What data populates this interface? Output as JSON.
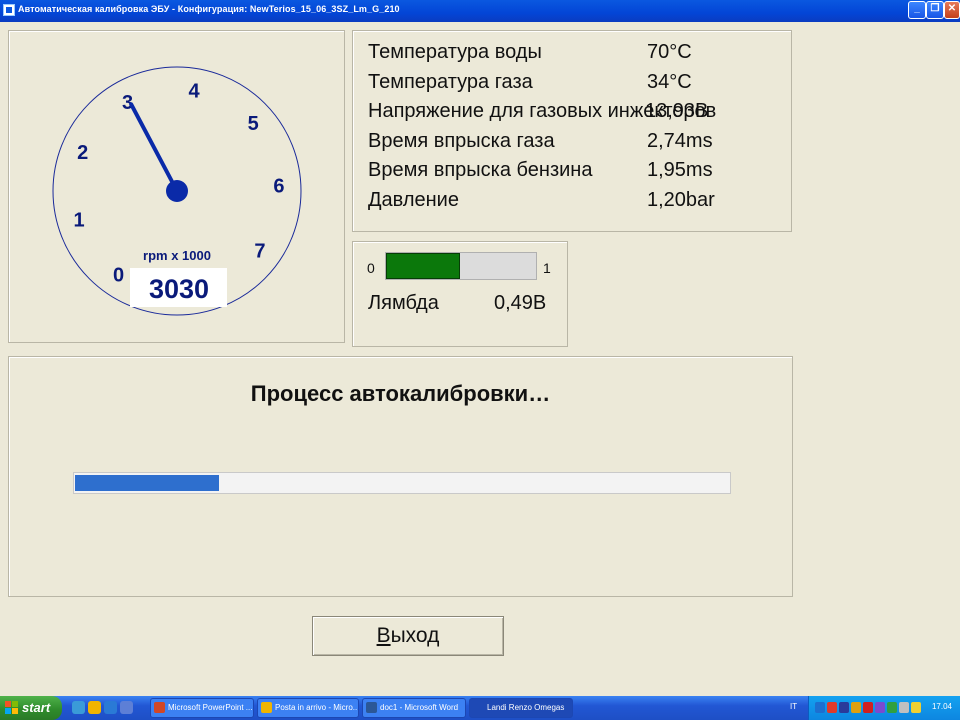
{
  "window": {
    "title": "Автоматическая калибровка ЭБУ - Конфигурация: NewTerios_15_06_3SZ_Lm_G_210"
  },
  "gauge": {
    "scale_labels": [
      "0",
      "1",
      "2",
      "3",
      "4",
      "5",
      "6",
      "7"
    ],
    "unit_label": "rpm x 1000",
    "rpm_value": "3030",
    "needle_value": 3.03,
    "needle_color": "#0a2aa8"
  },
  "parameters": [
    {
      "label": "Температура воды",
      "value": "70°C"
    },
    {
      "label": "Температура газа",
      "value": "34°C"
    },
    {
      "label": "Напряжение для газовых инжекторов",
      "value": "13,93В"
    },
    {
      "label": "Время впрыска газа",
      "value": "2,74ms"
    },
    {
      "label": "Время впрыска бензина",
      "value": "1,95ms"
    },
    {
      "label": "Давление",
      "value": "1,20bar"
    }
  ],
  "lambda": {
    "min_label": "0",
    "max_label": "1",
    "label": "Лямбда",
    "value": "0,49В",
    "bar_fraction": 0.49,
    "bar_color": "#0b780b"
  },
  "progress": {
    "title": "Процесс автокалибровки…",
    "fraction": 0.22,
    "bar_color": "#2e6fce"
  },
  "exit_button": {
    "accel": "В",
    "rest": "ыход"
  },
  "taskbar": {
    "start_label": "start",
    "tasks": [
      {
        "label": "Microsoft PowerPoint ...",
        "icon_color": "#d24726"
      },
      {
        "label": "Posta in arrivo - Micro...",
        "icon_color": "#f0b400"
      },
      {
        "label": "doc1 - Microsoft Word",
        "icon_color": "#2b5797"
      },
      {
        "label": "Landi Renzo Omegas",
        "icon_color": "#1e49b5"
      }
    ],
    "language": "IT",
    "clock": "17.04"
  }
}
